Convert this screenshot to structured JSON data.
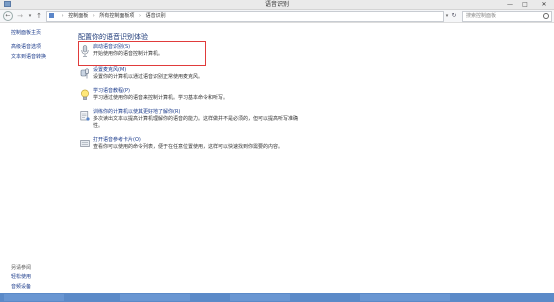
{
  "window": {
    "title": "语音识别",
    "minimize": "—",
    "maximize": "□",
    "close": "✕"
  },
  "nav": {
    "back": "←",
    "forward": "→",
    "recent": "▾",
    "up": "↑"
  },
  "address": {
    "crumbs": [
      "控制面板",
      "所有控制面板项",
      "语音识别"
    ],
    "separator": "›",
    "dropdown": "▾",
    "refresh": "↻",
    "search_placeholder": "搜索控制面板"
  },
  "sidebar": {
    "links": [
      "控制面板主页",
      "高级语音选项",
      "文本到语音转换"
    ],
    "see_also_title": "另请参阅",
    "see_also_links": [
      "轻松使用",
      "音频设备"
    ]
  },
  "main": {
    "title": "配置你的语音识别体验",
    "items": [
      {
        "name": "启动语音识别(S)",
        "desc": "开始使用你的语音控制计算机。",
        "icon": "microphone-icon"
      },
      {
        "name": "设置麦克风(M)",
        "desc": "设置你的计算机以通过语音识别正常使用麦克风。",
        "icon": "microphone-setup-icon"
      },
      {
        "name": "学习语音教程(P)",
        "desc": "学习通过使用你的语音来控制计算机。学习基本命令和听写。",
        "icon": "lightbulb-icon"
      },
      {
        "name": "训练你的计算机以使其更好地了解你(R)",
        "desc": "多次读出文本以提高计算机理解你的语音的能力。这样做并不是必须的，但可以提高听写准确",
        "desc2": "性。",
        "icon": "train-speech-icon"
      },
      {
        "name": "打开语音参考卡片(O)",
        "desc": "查看你可以使用的命令列表，便于在任意位置使用，这样可以快速找到你需要的内容。",
        "icon": "reference-card-icon"
      }
    ]
  },
  "colors": {
    "link": "#1a3a8a",
    "title": "#1e3a78",
    "highlight_border": "#e03b3b",
    "taskbar": "#5b8ac8"
  }
}
